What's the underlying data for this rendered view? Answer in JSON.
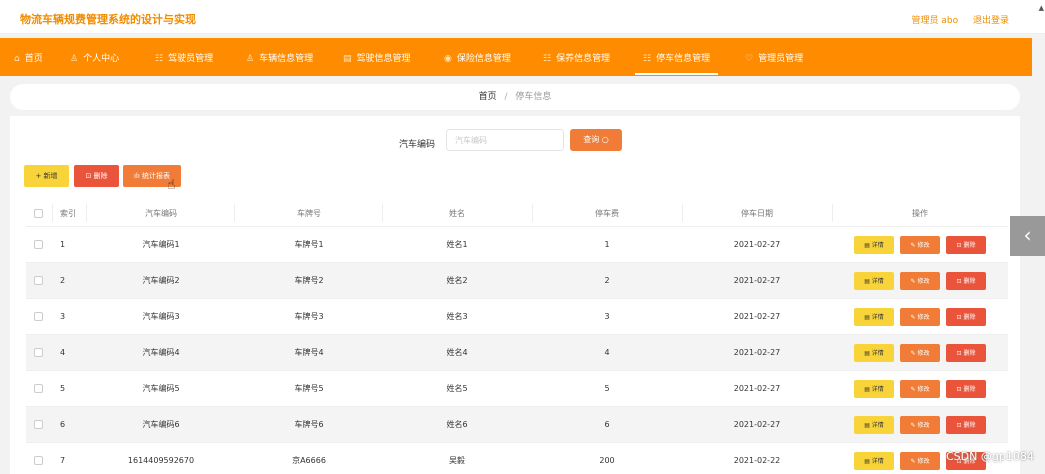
{
  "app": {
    "title": "物流车辆规费管理系统的设计与实现",
    "user_label": "管理员 abo",
    "logout_label": "退出登录"
  },
  "nav": [
    {
      "icon": "⌂",
      "label": "首页"
    },
    {
      "icon": "♙",
      "label": "个人中心"
    },
    {
      "icon": "☷",
      "label": "驾驶员管理"
    },
    {
      "icon": "♙",
      "label": "车辆信息管理"
    },
    {
      "icon": "▤",
      "label": "驾驶信息管理"
    },
    {
      "icon": "◉",
      "label": "保险信息管理"
    },
    {
      "icon": "☷",
      "label": "保养信息管理"
    },
    {
      "icon": "☷",
      "label": "停车信息管理"
    },
    {
      "icon": "♡",
      "label": "管理员管理"
    }
  ],
  "breadcrumb": {
    "home": "首页",
    "sep": "/",
    "current": "停车信息"
  },
  "search": {
    "label": "汽车编码",
    "placeholder": "汽车编码",
    "value": "",
    "button": "查询 ○"
  },
  "actions": {
    "add": "+ 新增",
    "delete": "⊡ 删除",
    "stats": "ılı 统计报表"
  },
  "table": {
    "headers": [
      "索引",
      "汽车编码",
      "车牌号",
      "姓名",
      "停车费",
      "停车日期",
      "操作"
    ],
    "rows": [
      {
        "idx": "1",
        "code": "汽车编码1",
        "plate": "车牌号1",
        "name": "姓名1",
        "fee": "1",
        "date": "2021-02-27"
      },
      {
        "idx": "2",
        "code": "汽车编码2",
        "plate": "车牌号2",
        "name": "姓名2",
        "fee": "2",
        "date": "2021-02-27"
      },
      {
        "idx": "3",
        "code": "汽车编码3",
        "plate": "车牌号3",
        "name": "姓名3",
        "fee": "3",
        "date": "2021-02-27"
      },
      {
        "idx": "4",
        "code": "汽车编码4",
        "plate": "车牌号4",
        "name": "姓名4",
        "fee": "4",
        "date": "2021-02-27"
      },
      {
        "idx": "5",
        "code": "汽车编码5",
        "plate": "车牌号5",
        "name": "姓名5",
        "fee": "5",
        "date": "2021-02-27"
      },
      {
        "idx": "6",
        "code": "汽车编码6",
        "plate": "车牌号6",
        "name": "姓名6",
        "fee": "6",
        "date": "2021-02-27"
      },
      {
        "idx": "7",
        "code": "1614409592670",
        "plate": "京A6666",
        "name": "吴毅",
        "fee": "200",
        "date": "2021-02-22"
      }
    ],
    "op_labels": {
      "detail": "▤ 详情",
      "edit": "✎ 修改",
      "delete": "⊡ 删除"
    }
  },
  "side_tab": "‹",
  "watermark": "CSDN @gp1084",
  "colors": {
    "accent": "#ff8c00",
    "yellow": "#f8d43a",
    "orange": "#f07c38",
    "red": "#e9543a"
  }
}
